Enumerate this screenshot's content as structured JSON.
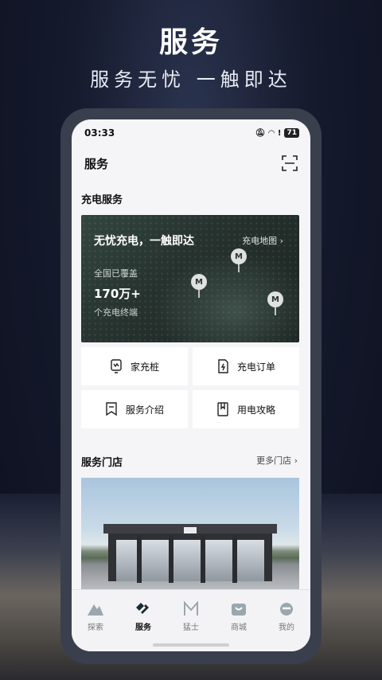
{
  "hero": {
    "title": "服务",
    "subtitle": "服务无忧 一触即达"
  },
  "status_bar": {
    "time": "03:33",
    "battery": "71"
  },
  "header": {
    "title": "服务",
    "scan_icon": "scan-icon"
  },
  "charging": {
    "section_title": "充电服务",
    "banner": {
      "title": "无忧充电，一触即达",
      "map_link": "充电地图",
      "coverage_label": "全国已覆盖",
      "count": "170万+",
      "count_unit": "个充电终端"
    },
    "tiles": [
      {
        "label": "家充桩",
        "icon": "home-charger-icon"
      },
      {
        "label": "充电订单",
        "icon": "charge-order-icon"
      },
      {
        "label": "服务介绍",
        "icon": "bookmark-icon"
      },
      {
        "label": "用电攻略",
        "icon": "guide-book-icon"
      }
    ]
  },
  "stores": {
    "section_title": "服务门店",
    "more_link": "更多门店"
  },
  "tabbar": {
    "items": [
      {
        "label": "探索",
        "icon": "explore-icon"
      },
      {
        "label": "服务",
        "icon": "service-icon",
        "active": true
      },
      {
        "label": "猛士",
        "icon": "mengshi-logo-icon"
      },
      {
        "label": "商城",
        "icon": "mall-icon"
      },
      {
        "label": "我的",
        "icon": "profile-icon"
      }
    ]
  },
  "colors": {
    "accent_dark": "#111111",
    "banner_bg": "#27332f"
  }
}
